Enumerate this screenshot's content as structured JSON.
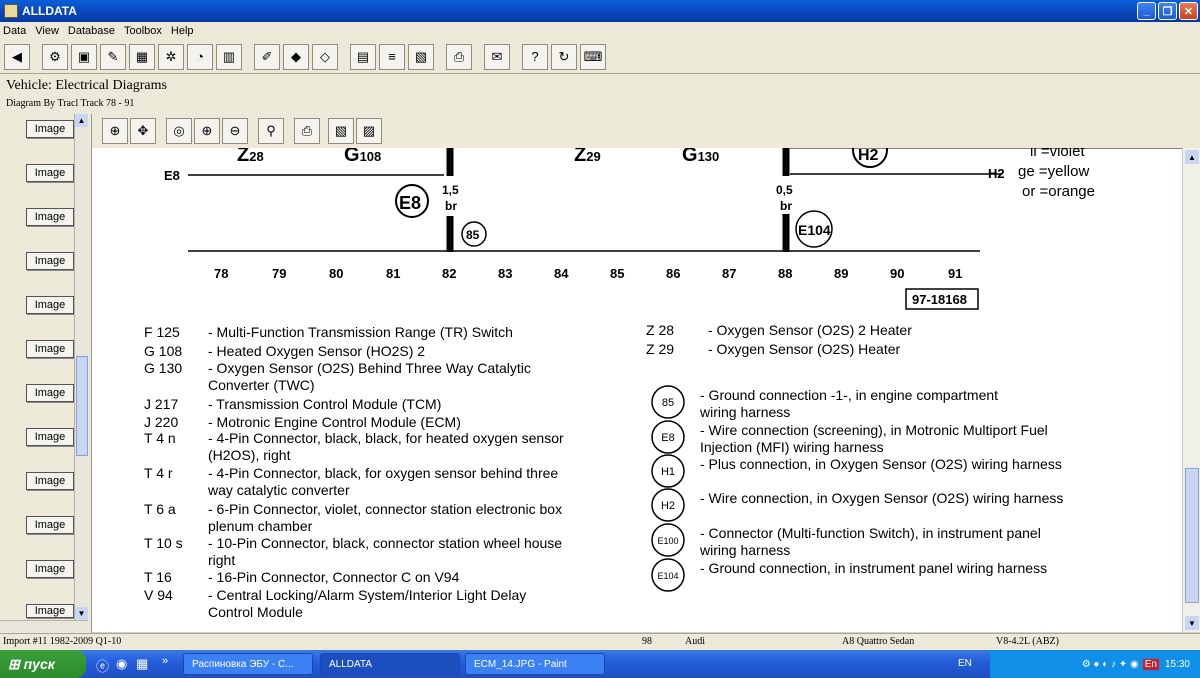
{
  "window": {
    "title": "ALLDATA"
  },
  "menu": [
    "Data",
    "View",
    "Database",
    "Toolbox",
    "Help"
  ],
  "header": {
    "title": "Vehicle:  Electrical Diagrams",
    "sub": "Diagram By Tracl  Track 78 - 91"
  },
  "side": {
    "button_label": "Image"
  },
  "diagram": {
    "top_labels": [
      {
        "t": "Z",
        "s": "28"
      },
      {
        "t": "G",
        "s": "108"
      },
      {
        "t": "Z",
        "s": "29"
      },
      {
        "t": "G",
        "s": "130"
      }
    ],
    "h2_label": "H2",
    "e8_label": "E8",
    "h2_line_label": "H2",
    "wire_1": {
      "size": "1,5",
      "color": "br"
    },
    "wire_2": {
      "size": "0,5",
      "color": "br"
    },
    "legend_colors": [
      "li =violet",
      "ge =yellow",
      "or =orange"
    ],
    "circle_e8": "E8",
    "circle_85": "85",
    "circle_e104": "E104",
    "track_numbers": [
      "78",
      "79",
      "80",
      "81",
      "82",
      "83",
      "84",
      "85",
      "86",
      "87",
      "88",
      "89",
      "90",
      "91"
    ],
    "ref_box": "97-18168",
    "left_legend": [
      {
        "code": "F   125",
        "desc": "- Multi-Function Transmission Range (TR) Switch"
      },
      {
        "code": "G   108",
        "desc": "- Heated Oxygen Sensor (HO2S) 2"
      },
      {
        "code": "G   130",
        "desc": "- Oxygen Sensor (O2S) Behind Three Way  Catalytic\n  Converter (TWC)"
      },
      {
        "code": "J   217",
        "desc": "- Transmission Control Module (TCM)"
      },
      {
        "code": "J   220",
        "desc": "- Motronic Engine Control Module (ECM)"
      },
      {
        "code": "T   4   n",
        "desc": "- 4-Pin Connector, black, black, for heated oxygen sensor\n  (H2OS), right"
      },
      {
        "code": "T   4   r",
        "desc": "- 4-Pin Connector, black, for oxygen sensor behind three\n  way catalytic converter"
      },
      {
        "code": "T   6   a",
        "desc": "- 6-Pin Connector, violet, connector station electronic box\n  plenum chamber"
      },
      {
        "code": "T   10   s",
        "desc": "- 10-Pin Connector, black, connector station wheel house\n  right"
      },
      {
        "code": "T   16",
        "desc": "- 16-Pin Connector, Connector C on V94"
      },
      {
        "code": "V   94",
        "desc": "- Central Locking/Alarm System/Interior Light Delay\n  Control Module"
      }
    ],
    "right_legend_top": [
      {
        "code": "Z   28",
        "desc": "- Oxygen Sensor (O2S) 2 Heater"
      },
      {
        "code": "Z   29",
        "desc": "- Oxygen Sensor (O2S) Heater"
      }
    ],
    "right_legend_circles": [
      {
        "code": "85",
        "desc": "- Ground connection -1-, in engine compartment\n  wiring harness"
      },
      {
        "code": "E8",
        "desc": "- Wire connection (screening), in Motronic Multiport Fuel\n  Injection (MFI) wiring harness"
      },
      {
        "code": "H1",
        "desc": "- Plus connection, in Oxygen Sensor (O2S) wiring harness"
      },
      {
        "code": "H2",
        "desc": "- Wire connection, in Oxygen Sensor (O2S) wiring harness"
      },
      {
        "code": "E100",
        "desc": "- Connector (Multi-function Switch), in instrument panel\n  wiring harness"
      },
      {
        "code": "E104",
        "desc": "- Ground connection, in instrument panel wiring harness"
      }
    ]
  },
  "status": {
    "left": "Import #11 1982-2009 Q1-10",
    "num": "98",
    "make": "Audi",
    "model": "A8 Quattro Sedan",
    "engine": "V8-4.2L (ABZ)"
  },
  "taskbar": {
    "start": "пуск",
    "tasks": [
      "Распиновка ЭБУ - С...",
      "ALLDATA",
      "ECM_14.JPG - Paint"
    ],
    "lang": "EN",
    "tray_lang": "En",
    "clock": "15:30"
  }
}
